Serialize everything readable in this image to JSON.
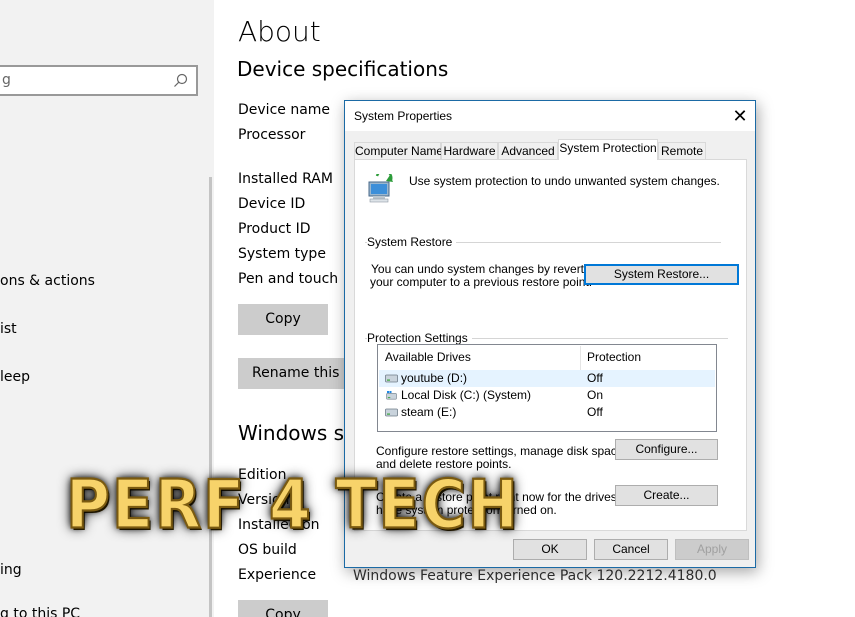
{
  "sidebar": {
    "search_placeholder": "g",
    "items": [
      {
        "label": "ons & actions"
      },
      {
        "label": "ist"
      },
      {
        "label": "leep"
      },
      {
        "label": "ing"
      },
      {
        "label": "g to this PC"
      }
    ]
  },
  "about": {
    "title": "About",
    "device_specs_title": "Device specifications",
    "spec_labels": [
      "Device name",
      "Processor",
      "Installed RAM",
      "Device ID",
      "Product ID",
      "System type",
      "Pen and touch"
    ],
    "copy_label": "Copy",
    "rename_label": "Rename this PC",
    "windows_specs_title": "Windows specifications",
    "win_labels": [
      "Edition",
      "Version",
      "Installed on",
      "OS build",
      "Experience"
    ],
    "experience_value": "Windows Feature Experience Pack 120.2212.4180.0",
    "copy2_label": "Copy"
  },
  "dialog": {
    "title": "System Properties",
    "tabs": [
      "Computer Name",
      "Hardware",
      "Advanced",
      "System Protection",
      "Remote"
    ],
    "active_tab": "System Protection",
    "intro": "Use system protection to undo unwanted system changes.",
    "restore_group": "System Restore",
    "restore_text_1": "You can undo system changes by reverting",
    "restore_text_2": "your computer to a previous restore point.",
    "restore_button": "System Restore...",
    "protection_group": "Protection Settings",
    "columns": [
      "Available Drives",
      "Protection"
    ],
    "drives": [
      {
        "name": "youtube (D:)",
        "protection": "Off",
        "icon": "drive-icon",
        "selected": true
      },
      {
        "name": "Local Disk (C:) (System)",
        "protection": "On",
        "icon": "system-drive-icon",
        "selected": false
      },
      {
        "name": "steam (E:)",
        "protection": "Off",
        "icon": "drive-icon",
        "selected": false
      }
    ],
    "configure_text_1": "Configure restore settings, manage disk space,",
    "configure_text_2": "and delete restore points.",
    "configure_button": "Configure...",
    "create_text_1": "Create a restore point right now for the drives that",
    "create_text_2": "have system protection turned on.",
    "create_button": "Create...",
    "ok_button": "OK",
    "cancel_button": "Cancel",
    "apply_button": "Apply"
  },
  "watermark": {
    "text": "PERF 4 TECH"
  },
  "colors": {
    "accent": "#0078d7",
    "dialog_border": "#1b6aa5",
    "sidebar_bg": "#f2f2f2",
    "button_gray": "#cccccc",
    "watermark_gold": "#f7d36a"
  }
}
